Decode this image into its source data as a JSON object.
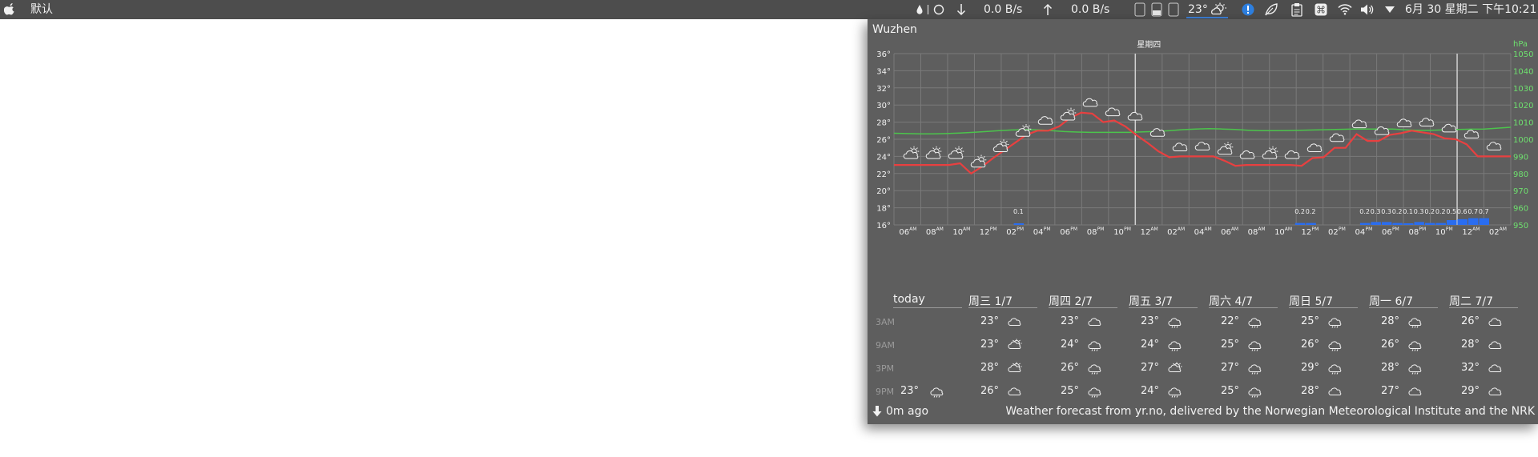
{
  "topbar": {
    "app_name": "默认",
    "net_down": "0.0 B/s",
    "net_up": "0.0 B/s",
    "weather_temp": "23°",
    "datetime": "6月 30 星期二 下午10:21"
  },
  "popup": {
    "location": "Wuzhen",
    "chart_day_marker": "星期四",
    "right_axis_unit": "hPa",
    "footer_ago": "0m ago",
    "footer_credit": "Weather forecast from yr.no, delivered by the Norwegian Meteorological Institute and the NRK"
  },
  "chart_data": {
    "type": "line",
    "x_tick_labels": [
      {
        "h": "06",
        "s": "AM"
      },
      {
        "h": "08",
        "s": "AM"
      },
      {
        "h": "10",
        "s": "AM"
      },
      {
        "h": "12",
        "s": "PM"
      },
      {
        "h": "02",
        "s": "PM"
      },
      {
        "h": "04",
        "s": "PM"
      },
      {
        "h": "06",
        "s": "PM"
      },
      {
        "h": "08",
        "s": "PM"
      },
      {
        "h": "10",
        "s": "PM"
      },
      {
        "h": "12",
        "s": "AM"
      },
      {
        "h": "02",
        "s": "AM"
      },
      {
        "h": "04",
        "s": "AM"
      },
      {
        "h": "06",
        "s": "AM"
      },
      {
        "h": "08",
        "s": "AM"
      },
      {
        "h": "10",
        "s": "AM"
      },
      {
        "h": "12",
        "s": "PM"
      },
      {
        "h": "02",
        "s": "PM"
      },
      {
        "h": "04",
        "s": "PM"
      },
      {
        "h": "06",
        "s": "PM"
      },
      {
        "h": "08",
        "s": "PM"
      },
      {
        "h": "10",
        "s": "PM"
      },
      {
        "h": "12",
        "s": "AM"
      },
      {
        "h": "02",
        "s": "AM"
      }
    ],
    "y_left_ticks": [
      "36°",
      "34°",
      "32°",
      "30°",
      "28°",
      "26°",
      "24°",
      "22°",
      "20°",
      "18°",
      "16°"
    ],
    "y_right_ticks": [
      "1050",
      "1040",
      "1030",
      "1020",
      "1010",
      "1000",
      "990",
      "980",
      "970",
      "960",
      "950"
    ],
    "ylim_temp": [
      16,
      36
    ],
    "ylim_pressure": [
      950,
      1050
    ],
    "temperature": [
      23,
      23,
      23,
      23,
      23,
      23,
      23.2,
      22,
      22.8,
      23.8,
      24.7,
      25.6,
      26.5,
      27,
      27,
      27.5,
      28.5,
      29.1,
      29,
      28,
      28.2,
      27.5,
      26.5,
      25.6,
      24.6,
      23.9,
      24,
      24,
      24,
      24,
      23.5,
      22.9,
      23,
      23,
      23,
      23,
      23,
      22.9,
      23.8,
      23.9,
      25,
      25,
      26.6,
      25.8,
      25.8,
      26.5,
      26.7,
      27,
      26.8,
      26.6,
      26.1,
      26,
      25.4,
      24,
      24,
      24,
      24
    ],
    "pressure": [
      1003.5,
      1003.3,
      1003.2,
      1003.2,
      1003.3,
      1003.6,
      1004,
      1004.5,
      1005,
      1005.4,
      1005.6,
      1005.5,
      1005,
      1004.5,
      1004.2,
      1004,
      1004,
      1004,
      1004,
      1004.3,
      1004.6,
      1005,
      1005.6,
      1006,
      1006.2,
      1006,
      1005.7,
      1005.3,
      1005,
      1005,
      1005.1,
      1005.3,
      1005.4,
      1005.6,
      1005.8,
      1006,
      1006,
      1006,
      1006,
      1005.5,
      1005.2,
      1005.3,
      1005.5,
      1005.7,
      1005.9,
      1006,
      1006.5,
      1007
    ],
    "precip_labels": [
      {
        "slot": 11,
        "v": "0.1"
      },
      {
        "slot": 37,
        "v": "0.2"
      },
      {
        "slot": 38,
        "v": "0.2"
      },
      {
        "slot": 43,
        "v": "0.2"
      },
      {
        "slot": 44,
        "v": "0.3"
      },
      {
        "slot": 45,
        "v": "0.3"
      },
      {
        "slot": 46,
        "v": "0.2"
      },
      {
        "slot": 47,
        "v": "0.1"
      },
      {
        "slot": 48,
        "v": "0.3"
      },
      {
        "slot": 49,
        "v": "0.2"
      },
      {
        "slot": 50,
        "v": "0.2"
      },
      {
        "slot": 51,
        "v": "0.5"
      },
      {
        "slot": 52,
        "v": "0.6"
      },
      {
        "slot": 53,
        "v": "0.7"
      },
      {
        "slot": 54,
        "v": "0.7"
      }
    ],
    "grid": true,
    "colors": {
      "temperature": "#e84040",
      "pressure": "#4cc44c",
      "precip": "#2a6df0",
      "right_axis": "#6ee06e"
    }
  },
  "forecast": {
    "today_label": "today",
    "row_labels": [
      "3AM",
      "9AM",
      "3PM",
      "9PM"
    ],
    "today_9pm": {
      "t": "23°",
      "icon": "rain-cloud-icon"
    },
    "days": [
      {
        "label": "周三 1/7",
        "cells": [
          {
            "t": "23°",
            "i": "cloud-icon"
          },
          {
            "t": "23°",
            "i": "sun-cloud-icon"
          },
          {
            "t": "28°",
            "i": "sun-cloud-icon"
          },
          {
            "t": "26°",
            "i": "cloud-icon"
          }
        ]
      },
      {
        "label": "周四 2/7",
        "cells": [
          {
            "t": "23°",
            "i": "cloud-icon"
          },
          {
            "t": "24°",
            "i": "rain-cloud-icon"
          },
          {
            "t": "26°",
            "i": "rain-cloud-icon"
          },
          {
            "t": "25°",
            "i": "rain-cloud-icon"
          }
        ]
      },
      {
        "label": "周五 3/7",
        "cells": [
          {
            "t": "23°",
            "i": "rain-cloud-icon"
          },
          {
            "t": "24°",
            "i": "rain-cloud-icon"
          },
          {
            "t": "27°",
            "i": "sun-cloud-icon"
          },
          {
            "t": "24°",
            "i": "rain-cloud-icon"
          }
        ]
      },
      {
        "label": "周六 4/7",
        "cells": [
          {
            "t": "22°",
            "i": "rain-cloud-icon"
          },
          {
            "t": "25°",
            "i": "rain-cloud-icon"
          },
          {
            "t": "27°",
            "i": "rain-cloud-icon"
          },
          {
            "t": "25°",
            "i": "rain-cloud-icon"
          }
        ]
      },
      {
        "label": "周日 5/7",
        "cells": [
          {
            "t": "25°",
            "i": "rain-cloud-icon"
          },
          {
            "t": "26°",
            "i": "rain-cloud-icon"
          },
          {
            "t": "29°",
            "i": "rain-cloud-icon"
          },
          {
            "t": "28°",
            "i": "cloud-icon"
          }
        ]
      },
      {
        "label": "周一 6/7",
        "cells": [
          {
            "t": "28°",
            "i": "rain-cloud-icon"
          },
          {
            "t": "26°",
            "i": "rain-cloud-icon"
          },
          {
            "t": "28°",
            "i": "rain-cloud-icon"
          },
          {
            "t": "27°",
            "i": "cloud-icon"
          }
        ]
      },
      {
        "label": "周二 7/7",
        "cells": [
          {
            "t": "26°",
            "i": "cloud-icon"
          },
          {
            "t": "28°",
            "i": "cloud-icon"
          },
          {
            "t": "32°",
            "i": "cloud-icon"
          },
          {
            "t": "29°",
            "i": "cloud-icon"
          }
        ]
      }
    ]
  }
}
